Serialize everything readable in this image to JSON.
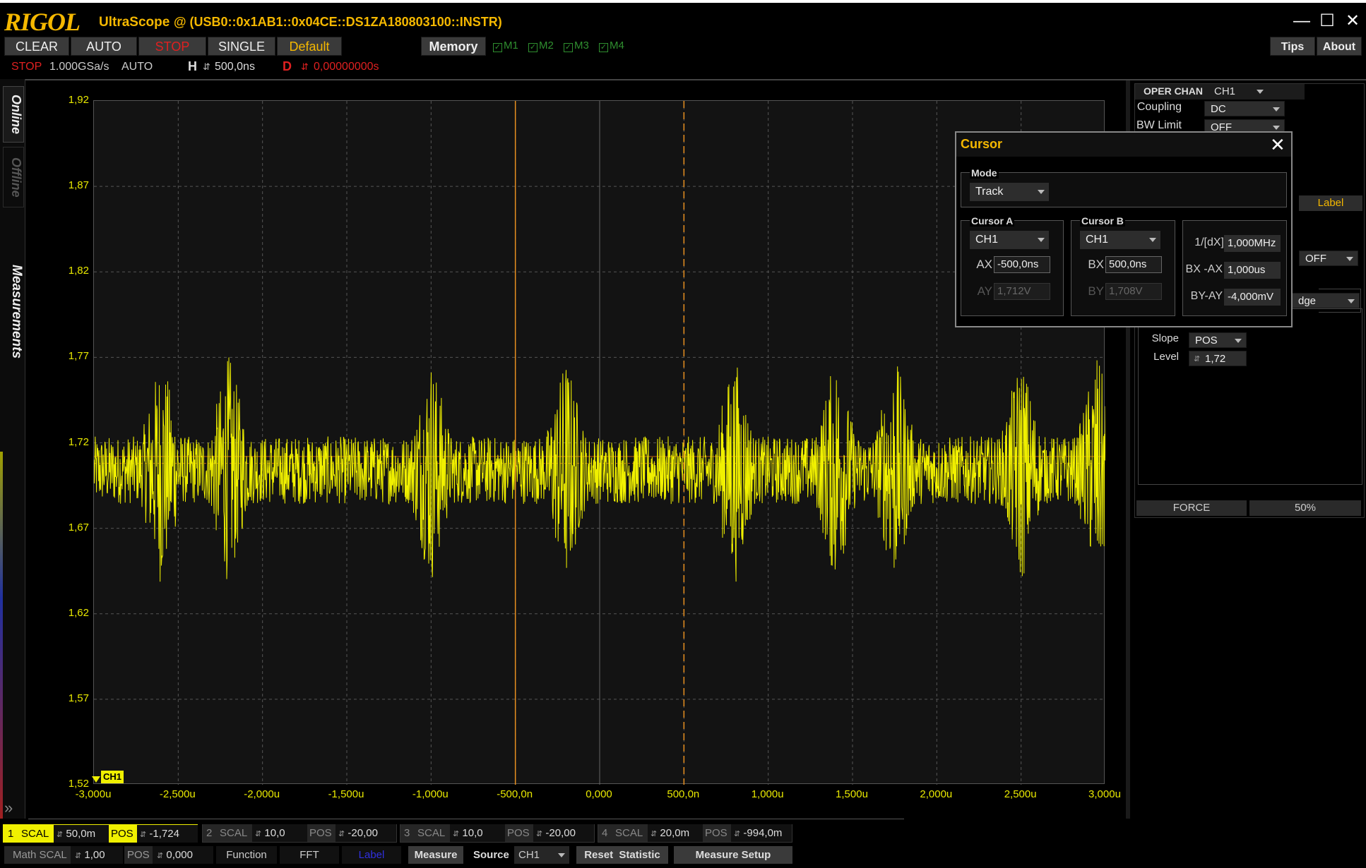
{
  "title": {
    "logo": "RIGOL",
    "app": "UltraScope",
    "instrument": "@ (USB0::0x1AB1::0x04CE::DS1ZA180803100::INSTR)"
  },
  "toolbar": {
    "clear": "CLEAR",
    "auto": "AUTO",
    "stop": "STOP",
    "single": "SINGLE",
    "default": "Default",
    "memory": "Memory",
    "m1": "M1",
    "m2": "M2",
    "m3": "M3",
    "m4": "M4",
    "tips": "Tips",
    "about": "About"
  },
  "status": {
    "run_state": "STOP",
    "sample_rate": "1.000GSa/s",
    "trigger_mode": "AUTO",
    "h_label": "H",
    "h_value": "500,0ns",
    "d_label": "D",
    "d_value": "0,00000000s"
  },
  "left_tabs": {
    "online": "Online",
    "offline": "Offline",
    "measurements": "Measurements"
  },
  "chart_data": {
    "type": "line",
    "y_ticks": [
      "1,92",
      "1,87",
      "1,82",
      "1,77",
      "1,72",
      "1,67",
      "1,62",
      "1,57",
      "1,52"
    ],
    "x_ticks": [
      "-3,000u",
      "-2,500u",
      "-2,000u",
      "-1,500u",
      "-1,000u",
      "-500,0n",
      "0,000",
      "500,0n",
      "1,000u",
      "1,500u",
      "2,000u",
      "2,500u",
      "3,000u"
    ],
    "ylim": [
      1.52,
      1.92
    ],
    "xlim": [
      -3.0,
      3.0
    ],
    "x_unit": "us",
    "series": [
      {
        "channel": "CH1",
        "color": "#f0f000",
        "baseline": 1.704,
        "noise_peak_to_peak": 0.09
      }
    ],
    "channel_marker": "CH1",
    "cursor_a_x": -0.5,
    "cursor_b_x": 0.5,
    "cursor_ay": 1.712,
    "cursor_by": 1.708,
    "cursor_color": "#e89020",
    "grid": true
  },
  "right_panel": {
    "oper_chan_label": "OPER CHAN",
    "oper_chan_value": "CH1",
    "coupling_label": "Coupling",
    "coupling_value": "DC",
    "bw_limit_label": "BW Limit",
    "bw_limit_value": "OFF",
    "label_button": "Label",
    "off_value": "OFF",
    "trigger_type_partial": "dge",
    "slope_label": "Slope",
    "slope_value": "POS",
    "level_label": "Level",
    "level_value": "1,72",
    "force": "FORCE",
    "fifty": "50%"
  },
  "cursor_dialog": {
    "title": "Cursor",
    "mode_label": "Mode",
    "mode_value": "Track",
    "cursor_a_label": "Cursor A",
    "cursor_a_source": "CH1",
    "ax_label": "AX",
    "ax_value": "-500,0ns",
    "ay_label": "AY",
    "ay_value": "1,712V",
    "cursor_b_label": "Cursor B",
    "cursor_b_source": "CH1",
    "bx_label": "BX",
    "bx_value": "500,0ns",
    "by_label": "BY",
    "by_value": "1,708V",
    "inv_dx_label": "1/[dX]",
    "inv_dx_value": "1,000MHz",
    "bx_ax_label": "BX -AX",
    "bx_ax_value": "1,000us",
    "by_ay_label": "BY-AY",
    "by_ay_value": "-4,000mV"
  },
  "channels": [
    {
      "num": "1",
      "scal_label": "SCAL",
      "scal": "50,0m",
      "pos_label": "POS",
      "pos": "-1,724"
    },
    {
      "num": "2",
      "scal_label": "SCAL",
      "scal": "10,0",
      "pos_label": "POS",
      "pos": "-20,00"
    },
    {
      "num": "3",
      "scal_label": "SCAL",
      "scal": "10,0",
      "pos_label": "POS",
      "pos": "-20,00"
    },
    {
      "num": "4",
      "scal_label": "SCAL",
      "scal": "20,0m",
      "pos_label": "POS",
      "pos": "-994,0m"
    }
  ],
  "math_bar": {
    "math_label": "Math SCAL",
    "math_scal": "1,00",
    "pos_label": "POS",
    "pos": "0,000",
    "function": "Function",
    "fft": "FFT",
    "label": "Label",
    "measure": "Measure",
    "source_label": "Source",
    "source_value": "CH1",
    "reset": "Reset",
    "statistic": "Statistic",
    "measure_setup": "Measure Setup"
  },
  "colors": {
    "accent": "#f5b800",
    "ch1": "#f0f000",
    "stop": "#e02020"
  }
}
